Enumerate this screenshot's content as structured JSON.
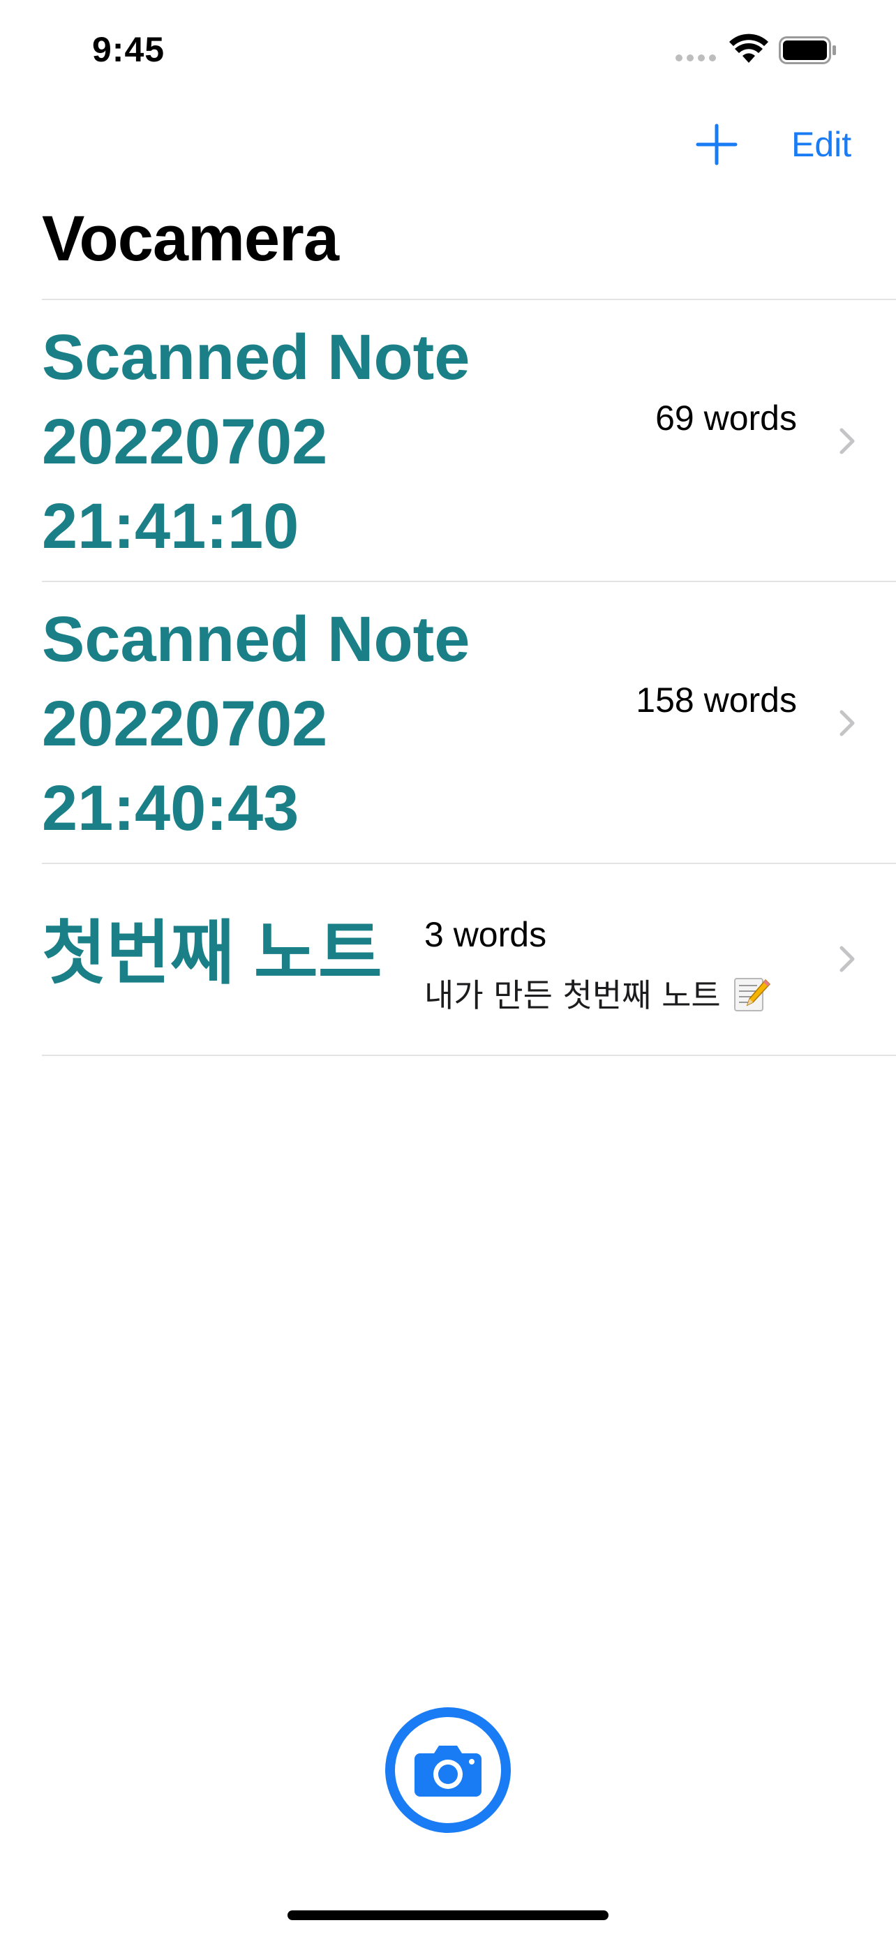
{
  "status_bar": {
    "time": "9:45"
  },
  "nav": {
    "add_icon": "plus-icon",
    "edit_label": "Edit"
  },
  "title": "Vocamera",
  "notes": [
    {
      "title": "Scanned Note 20220702 21:41:10",
      "count": "69 words",
      "subtitle": ""
    },
    {
      "title": "Scanned Note 20220702 21:40:43",
      "count": "158 words",
      "subtitle": ""
    },
    {
      "title": "첫번째 노트",
      "count": "3 words",
      "subtitle": "내가 만든 첫번째 노트"
    }
  ],
  "colors": {
    "accent": "#1a7cf5",
    "note_title": "#1a7f86",
    "divider": "#e3e3e6"
  },
  "camera_icon": "camera-icon"
}
